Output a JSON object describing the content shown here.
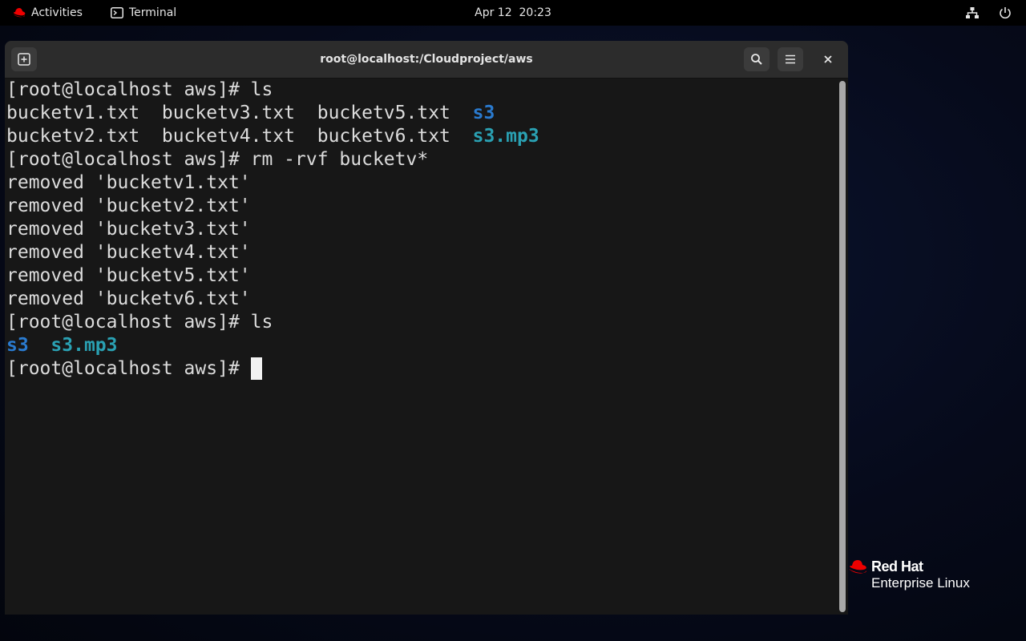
{
  "topbar": {
    "activities_label": "Activities",
    "app_menu_label": "Terminal",
    "clock": "Apr 12  20:23",
    "icons": {
      "activities": "redhat-hat-icon",
      "app": "terminal-app-icon",
      "network": "network-wired-icon",
      "power": "power-icon"
    }
  },
  "window": {
    "title": "root@localhost:/Cloudproject/aws",
    "buttons": {
      "new_tab": "new-tab-icon",
      "search": "search-icon",
      "menu": "hamburger-menu-icon",
      "close": "close-icon"
    }
  },
  "terminal": {
    "lines": [
      [
        {
          "t": "[root@localhost aws]# ls"
        }
      ],
      [
        {
          "t": "bucketv1.txt  bucketv3.txt  bucketv5.txt  "
        },
        {
          "t": "s3",
          "c": "dir"
        }
      ],
      [
        {
          "t": "bucketv2.txt  bucketv4.txt  bucketv6.txt  "
        },
        {
          "t": "s3.mp3",
          "c": "exec"
        }
      ],
      [
        {
          "t": "[root@localhost aws]# rm -rvf bucketv*"
        }
      ],
      [
        {
          "t": "removed 'bucketv1.txt'"
        }
      ],
      [
        {
          "t": "removed 'bucketv2.txt'"
        }
      ],
      [
        {
          "t": "removed 'bucketv3.txt'"
        }
      ],
      [
        {
          "t": "removed 'bucketv4.txt'"
        }
      ],
      [
        {
          "t": "removed 'bucketv5.txt'"
        }
      ],
      [
        {
          "t": "removed 'bucketv6.txt'"
        }
      ],
      [
        {
          "t": "[root@localhost aws]# ls"
        }
      ],
      [
        {
          "t": "s3",
          "c": "dir"
        },
        {
          "t": "  "
        },
        {
          "t": "s3.mp3",
          "c": "exec"
        }
      ],
      [
        {
          "t": "[root@localhost aws]# "
        },
        {
          "cursor": true
        }
      ]
    ],
    "colors": {
      "dir": "#2a7bd0",
      "exec": "#2aa1b3",
      "text": "#dcdcdc",
      "background": "#171717"
    }
  },
  "desktop": {
    "logo_brand": "Red Hat",
    "logo_product": "Enterprise Linux",
    "brand_color": "#ee0000"
  }
}
